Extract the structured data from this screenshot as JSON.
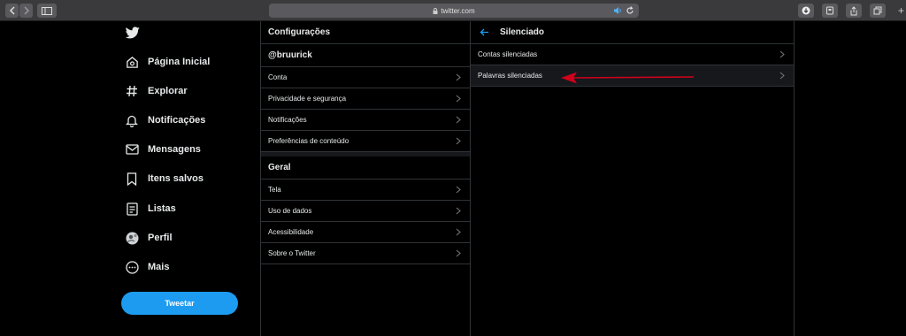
{
  "browser": {
    "url": "twitter.com"
  },
  "nav": {
    "items": [
      {
        "label": "Página Inicial",
        "icon": "home-icon"
      },
      {
        "label": "Explorar",
        "icon": "hashtag-icon"
      },
      {
        "label": "Notificações",
        "icon": "bell-icon"
      },
      {
        "label": "Mensagens",
        "icon": "envelope-icon"
      },
      {
        "label": "Itens salvos",
        "icon": "bookmark-icon"
      },
      {
        "label": "Listas",
        "icon": "list-icon"
      },
      {
        "label": "Perfil",
        "icon": "avatar-icon"
      },
      {
        "label": "Mais",
        "icon": "more-icon"
      }
    ],
    "tweet_button": "Tweetar"
  },
  "settings": {
    "title": "Configurações",
    "account_section": "@bruurick",
    "account_items": [
      "Conta",
      "Privacidade e segurança",
      "Notificações",
      "Preferências de conteúdo"
    ],
    "general_section": "Geral",
    "general_items": [
      "Tela",
      "Uso de dados",
      "Acessibilidade",
      "Sobre o Twitter"
    ]
  },
  "muted": {
    "title": "Silenciado",
    "items": [
      "Contas silenciadas",
      "Palavras silenciadas"
    ]
  },
  "colors": {
    "accent": "#1d9bf0",
    "annotation_arrow": "#d0021b",
    "background": "#000000"
  }
}
